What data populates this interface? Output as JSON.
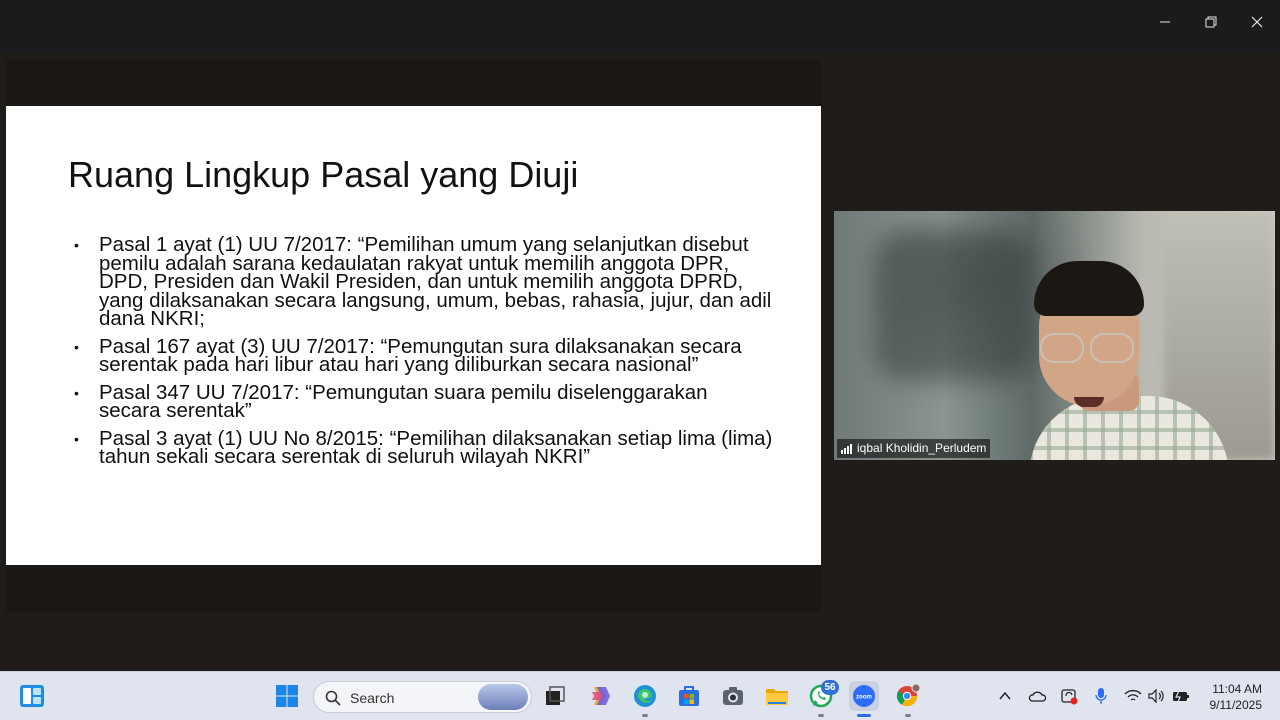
{
  "slide": {
    "title": "Ruang Lingkup Pasal yang Diuji",
    "bullets": [
      "Pasal 1 ayat (1) UU 7/2017: “Pemilihan umum yang selanjutkan disebut pemilu adalah sarana kedaulatan rakyat untuk memilih anggota DPR, DPD, Presiden dan Wakil Presiden, dan untuk memilih anggota DPRD, yang dilaksanakan secara langsung, umum, bebas, rahasia, jujur, dan adil dana NKRI;",
      "Pasal 167 ayat (3) UU 7/2017: “Pemungutan sura dilaksanakan secara serentak pada hari libur atau hari yang diliburkan secara nasional”",
      "Pasal 347 UU 7/2017: “Pemungutan suara pemilu diselenggarakan secara serentak”",
      "Pasal 3 ayat (1) UU No 8/2015: “Pemilihan dilaksanakan setiap lima (lima) tahun sekali secara serentak di seluruh wilayah NKRI”"
    ]
  },
  "video": {
    "participant_name": "iqbal Kholidin_Perludem"
  },
  "window_controls": {
    "minimize_icon": "minimize-icon",
    "restore_icon": "restore-icon",
    "close_icon": "close-icon"
  },
  "taskbar": {
    "search_placeholder": "Search",
    "whatsapp_badge": "56",
    "apps": [
      "start",
      "search",
      "task-view",
      "copilot",
      "edge",
      "store",
      "camera",
      "file-explorer",
      "whatsapp",
      "zoom",
      "chrome"
    ],
    "clock": {
      "time": "11:04 AM",
      "date": "9/11/2025"
    },
    "accent_color": "#2f6fd6"
  }
}
